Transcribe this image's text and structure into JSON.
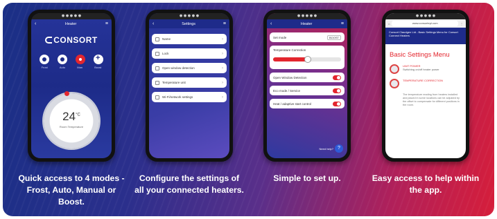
{
  "captions": [
    "Quick access to 4 modes - Frost, Auto, Manual or Boost.",
    "Configure the settings of all your connected heaters.",
    "Simple to set up.",
    "Easy access to help within the app."
  ],
  "phone1": {
    "title": "Heater",
    "logo": "CONSORT",
    "modes": [
      "Frost",
      "Auto",
      "Man",
      "Boost"
    ],
    "temperature": "24",
    "temp_unit": "°C",
    "temp_sub": "Room Temperature"
  },
  "phone2": {
    "title": "Settings",
    "items": [
      "Name",
      "Lock",
      "Open window detection",
      "Temperature unit",
      "Wi-Fi/network settings"
    ]
  },
  "phone3": {
    "title": "Heater",
    "rows": [
      "Set mode"
    ],
    "mode_value": "BOOST",
    "card_label": "Temperature Correction",
    "toggles": [
      "Open Window Detection",
      "Eco mode / Service",
      "Heat / adaptive start control"
    ],
    "help_label": "Need help?",
    "help_icon": "?"
  },
  "phone4": {
    "url": "www.consortepl.com",
    "header_text": "Consort Claudgen Ltd - Basic Settings Menu for Consort Connect Heaters",
    "heading": "Basic Settings Menu",
    "entries": [
      {
        "title": "UNIT POWER",
        "sub": "Switching on/off heater power"
      },
      {
        "title": "TEMPERATURE CORRECTION",
        "sub": ""
      }
    ],
    "paragraph": "The temperature reading from heaters installed and placed in some locations can be adjusted by the offset to compensate for different positions in the room."
  },
  "colors": {
    "accent_red": "#e3262e",
    "brand_blue": "#1e2b8a"
  }
}
